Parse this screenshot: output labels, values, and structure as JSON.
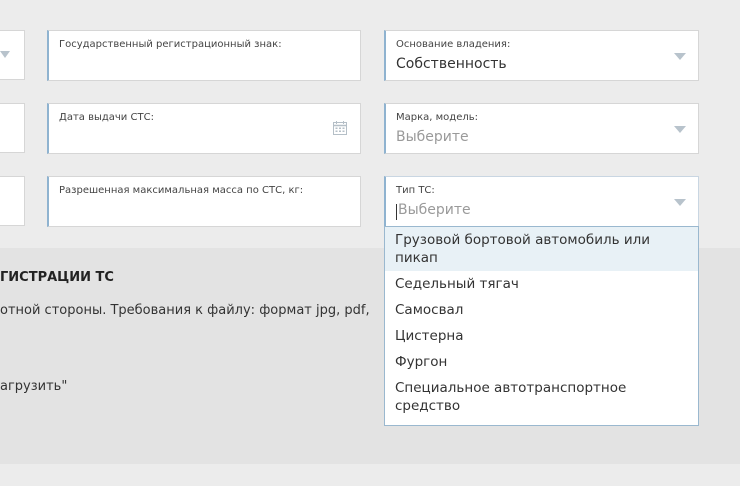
{
  "form": {
    "reg_sign": {
      "label": "Государственный регистрационный знак:",
      "value": ""
    },
    "ownership": {
      "label": "Основание владения:",
      "value": "Собственность",
      "icon": "chevron-down-icon"
    },
    "sts_date": {
      "label": "Дата выдачи СТС:",
      "value": "",
      "icon": "calendar-icon"
    },
    "brand_model": {
      "label": "Марка, модель:",
      "placeholder": "Выберите",
      "icon": "chevron-down-icon"
    },
    "max_mass": {
      "label": "Разрешенная максимальная масса по СТС, кг:",
      "value": ""
    },
    "vehicle_type": {
      "label": "Тип ТС:",
      "placeholder": "Выберите",
      "icon": "chevron-down-icon",
      "options": [
        "Грузовой бортовой автомобиль или пикап",
        "Седельный тягач",
        "Самосвал",
        "Цистерна",
        "Фургон",
        "Специальное автотранспортное средство"
      ],
      "highlighted_index": 0
    }
  },
  "section": {
    "title": "ГИСТРАЦИИ ТС",
    "text": "отной стороны. Требования к файлу: формат jpg, pdf,",
    "upload_text": "агрузить\""
  },
  "colors": {
    "accent_border": "#8fb3d0",
    "highlight": "#e8f1f6",
    "page_bg": "#ececec"
  }
}
